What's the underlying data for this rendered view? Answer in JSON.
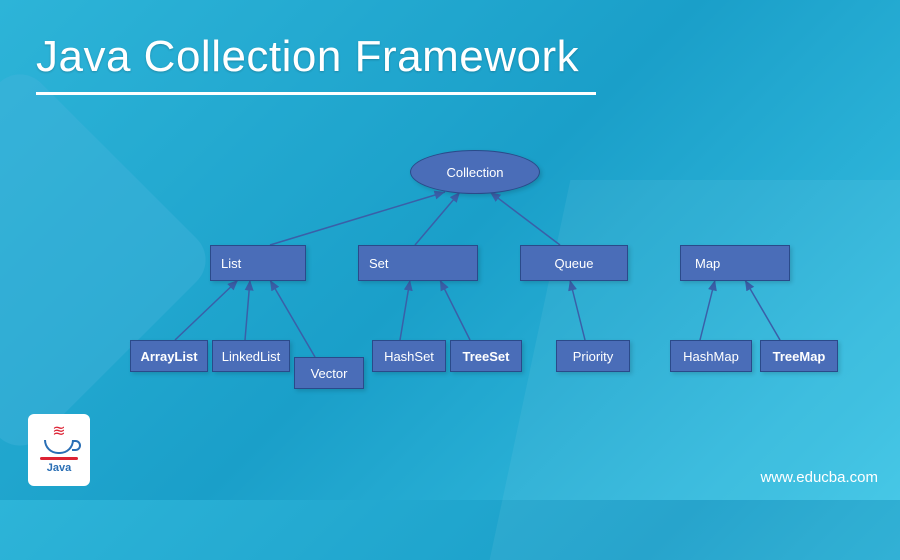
{
  "title": "Java Collection Framework",
  "watermark": "www.educba.com",
  "logo": {
    "label": "Java"
  },
  "nodes": {
    "collection": "Collection",
    "list": "List",
    "set": "Set",
    "queue": "Queue",
    "map": "Map",
    "arraylist": "ArrayList",
    "linkedlist": "LinkedList",
    "vector": "Vector",
    "hashset": "HashSet",
    "treeset": "TreeSet",
    "priority": "Priority",
    "hashmap": "HashMap",
    "treemap": "TreeMap"
  },
  "hierarchy": {
    "root": "Collection",
    "children": [
      {
        "name": "List",
        "children": [
          "ArrayList",
          "LinkedList",
          "Vector"
        ]
      },
      {
        "name": "Set",
        "children": [
          "HashSet",
          "TreeSet"
        ]
      },
      {
        "name": "Queue",
        "children": [
          "Priority"
        ]
      },
      {
        "name": "Map",
        "children": [
          "HashMap",
          "TreeMap"
        ]
      }
    ]
  }
}
